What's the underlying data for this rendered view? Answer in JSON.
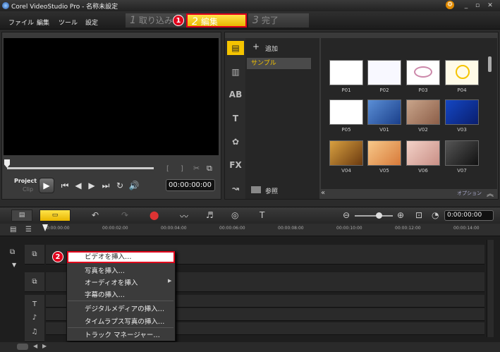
{
  "app": {
    "title": "Corel VideoStudio Pro - 名称未設定"
  },
  "menu": {
    "items": [
      "ファイル",
      "編集",
      "ツール",
      "設定"
    ]
  },
  "steps": [
    {
      "num": "1",
      "label": "取り込み"
    },
    {
      "num": "2",
      "label": "編集"
    },
    {
      "num": "3",
      "label": "完了"
    }
  ],
  "annotations": {
    "badge1": "1",
    "badge2": "2"
  },
  "preview": {
    "project_label": "Project",
    "clip_label": "Clip",
    "timecode": "00:00:00:00",
    "bracket_in": "[",
    "bracket_out": "]"
  },
  "library": {
    "add_label": "追加",
    "folder_selected": "サンプル",
    "browse_label": "参照",
    "options_label": "オプション",
    "thumbnails": [
      "P01",
      "P02",
      "P03",
      "P04",
      "P05",
      "V01",
      "V02",
      "V03",
      "V04",
      "V05",
      "V06",
      "V07"
    ]
  },
  "timeline": {
    "timecode": "0:00:00:00",
    "ruler": [
      "00:00:00:00",
      "00:00:02:00",
      "00:00:04:00",
      "00:00:06:00",
      "00:00:08:00",
      "00:00:10:00",
      "00:00:12:00",
      "00:00:14:00"
    ]
  },
  "context_menu": {
    "items": [
      "ビデオを挿入…",
      "写真を挿入…",
      "オーディオを挿入",
      "字幕の挿入…",
      "デジタルメディアの挿入…",
      "タイムラプス写真の挿入…",
      "トラック マネージャー…"
    ]
  },
  "colors": {
    "accent": "#f5c400",
    "highlight_border": "#e0001c"
  }
}
